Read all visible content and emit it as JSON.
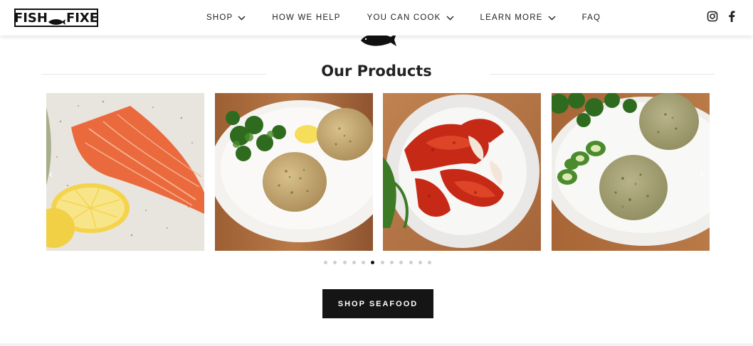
{
  "header": {
    "logo": {
      "left": "FISH",
      "right": "FIXE"
    },
    "nav": [
      {
        "label": "SHOP",
        "dropdown": true
      },
      {
        "label": "HOW WE HELP",
        "dropdown": false
      },
      {
        "label": "YOU CAN COOK",
        "dropdown": true
      },
      {
        "label": "LEARN MORE",
        "dropdown": true
      },
      {
        "label": "FAQ",
        "dropdown": false
      }
    ],
    "social": [
      "instagram-icon",
      "facebook-icon"
    ]
  },
  "section": {
    "title": "Our Products"
  },
  "carousel": {
    "cards": [
      {
        "name": "salmon-fillet-image"
      },
      {
        "name": "crab-cakes-parsley-image"
      },
      {
        "name": "lobster-bowl-image"
      },
      {
        "name": "crab-cakes-jalapeno-image"
      }
    ],
    "prev_arrow": "‹",
    "next_arrow": "›",
    "dots_total": 12,
    "active_dot": 5
  },
  "cta": {
    "label": "SHOP SEAFOOD"
  },
  "colors": {
    "text": "#222222",
    "cta_bg": "#151515",
    "dot": "#cfcfcf",
    "dot_active": "#111111"
  }
}
